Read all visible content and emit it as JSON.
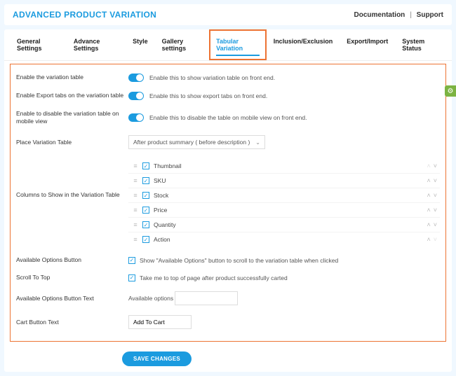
{
  "header": {
    "title": "ADVANCED PRODUCT VARIATION",
    "doc_link": "Documentation",
    "support_link": "Support"
  },
  "tabs": [
    {
      "label": "General Settings"
    },
    {
      "label": "Advance Settings"
    },
    {
      "label": "Style"
    },
    {
      "label": "Gallery settings"
    },
    {
      "label": "Tabular Variation"
    },
    {
      "label": "Inclusion/Exclusion"
    },
    {
      "label": "Export/Import"
    },
    {
      "label": "System Status"
    }
  ],
  "settings": {
    "enable_table": {
      "label": "Enable the variation table",
      "desc": "Enable this to show variation table on front end."
    },
    "enable_export": {
      "label": "Enable Export tabs on the variation table",
      "desc": "Enable this to show export tabs on front end."
    },
    "disable_mobile": {
      "label": "Enable to disable the variation table on mobile view",
      "desc": "Enable this to disable the table on mobile view on front end."
    },
    "place_table": {
      "label": "Place Variation Table",
      "selected": "After product summary ( before description )"
    },
    "columns_label": "Columns to Show in the Variation Table",
    "columns": [
      {
        "name": "Thumbnail",
        "checked": true,
        "up_disabled": true,
        "down_disabled": false
      },
      {
        "name": "SKU",
        "checked": true,
        "up_disabled": false,
        "down_disabled": false
      },
      {
        "name": "Stock",
        "checked": true,
        "up_disabled": false,
        "down_disabled": false
      },
      {
        "name": "Price",
        "checked": true,
        "up_disabled": false,
        "down_disabled": false
      },
      {
        "name": "Quantity",
        "checked": true,
        "up_disabled": false,
        "down_disabled": false
      },
      {
        "name": "Action",
        "checked": true,
        "up_disabled": false,
        "down_disabled": true
      }
    ],
    "avail_btn": {
      "label": "Available Options Button",
      "desc": "Show \"Available Options\" button to scroll to the variation table when clicked"
    },
    "scroll_top": {
      "label": "Scroll To Top",
      "desc": "Take me to top of page after product successfully carted"
    },
    "avail_text": {
      "label": "Available Options Button Text",
      "prefix": "Available options",
      "value": ""
    },
    "cart_text": {
      "label": "Cart Button Text",
      "value": "Add To Cart"
    },
    "save_btn": "SAVE CHANGES"
  },
  "fab_icon": "gear-icon"
}
